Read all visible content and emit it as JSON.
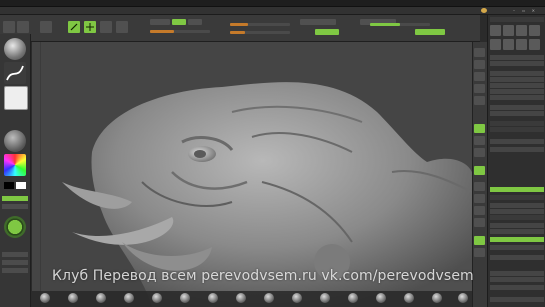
{
  "watermark": "Клуб Перевод всем    perevodvsem.ru  vk.com/perevodvsem",
  "colors": {
    "accent_green": "#7fc843",
    "slider_orange": "#c57a2a",
    "viewport_bg": "#454545",
    "panel_bg": "#3a3a3a"
  },
  "icons": {
    "brush": "sphere-brush-icon",
    "stroke": "stroke-icon",
    "alpha": "alpha-icon",
    "material": "material-icon",
    "color": "color-picker-icon",
    "gizmo": "gizmo-icon"
  },
  "sculpt_model": "creature-head"
}
